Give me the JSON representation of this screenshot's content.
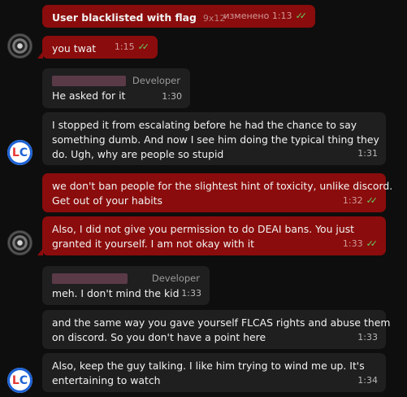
{
  "messages": [
    {
      "text": "User blacklisted with flag",
      "bold": true,
      "count": "9x12",
      "status": "изменено 1:13",
      "check": "✓✓"
    },
    {
      "text": "you twat",
      "time": "1:15",
      "check": "✓✓"
    },
    {
      "role": "Developer",
      "text": "He asked for it",
      "time": "1:30"
    },
    {
      "lines": [
        "I stopped it from escalating before he had the chance to say",
        "something dumb. And now I see him doing the typical thing they",
        "do. Ugh, why are people so stupid"
      ],
      "time": "1:31"
    },
    {
      "lines": [
        "we don't ban people for the slightest hint of toxicity, unlike discord.",
        "Get out of your habits"
      ],
      "time": "1:32",
      "check": "✓✓"
    },
    {
      "lines": [
        "Also, I did not give you permission to do DEAI bans. You just",
        "granted it yourself. I am not okay with it"
      ],
      "time": "1:33",
      "check": "✓✓"
    },
    {
      "role": "Developer",
      "text": "meh. I don't mind the kid",
      "time": "1:33"
    },
    {
      "lines": [
        "and the same way you gave yourself FLCAS rights and abuse them",
        "on discord. So you don't have a point here"
      ],
      "time": "1:33"
    },
    {
      "lines": [
        "Also, keep the guy talking. I like him trying to wind me up. It's",
        "entertaining to watch"
      ],
      "time": "1:34"
    }
  ],
  "avatars": {
    "wheel_icon": "wheel-avatar-icon",
    "lc_text_l": "L",
    "lc_text_c": "C"
  },
  "colors": {
    "outgoing_bubble": "#8b0c0c",
    "incoming_bubble": "#1f1f1f",
    "background": "#0e0e0e",
    "check": "#62d162"
  }
}
